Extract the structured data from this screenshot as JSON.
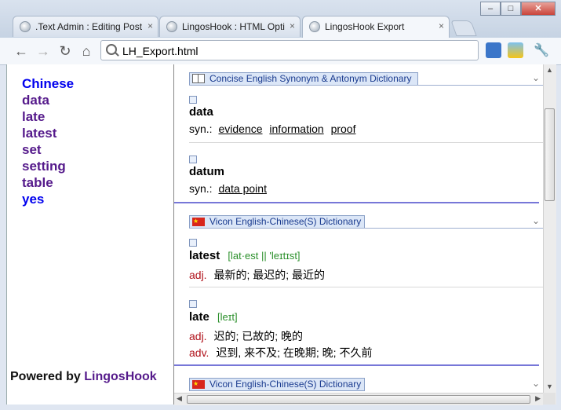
{
  "tabs": [
    {
      "label": ".Text Admin : Editing Post",
      "close": "×"
    },
    {
      "label": "LingosHook : HTML Opti",
      "close": "×"
    },
    {
      "label": "LingosHook Export",
      "close": "×"
    }
  ],
  "window_controls": {
    "minimize": "–",
    "maximize": "□",
    "close": "✕"
  },
  "address": {
    "value": "LH_Export.html"
  },
  "word_list": [
    {
      "word": "Chinese",
      "state": "unvisited"
    },
    {
      "word": "data",
      "state": "visited"
    },
    {
      "word": "late",
      "state": "visited"
    },
    {
      "word": "latest",
      "state": "visited"
    },
    {
      "word": "set",
      "state": "visited"
    },
    {
      "word": "setting",
      "state": "visited"
    },
    {
      "word": "table",
      "state": "visited"
    },
    {
      "word": "yes",
      "state": "unvisited"
    }
  ],
  "powered": {
    "prefix": "Powered by ",
    "brand": "LingosHook"
  },
  "dictionary_sections": [
    {
      "name": "Concise English Synonym & Antonym Dictionary",
      "icon": "book-icon",
      "entries": [
        {
          "headword": "data",
          "syn_label": "syn.:",
          "synonyms": [
            "evidence",
            "information",
            "proof"
          ]
        },
        {
          "headword": "datum",
          "syn_label": "syn.:",
          "synonyms": [
            "data point"
          ]
        }
      ]
    },
    {
      "name": "Vicon English-Chinese(S) Dictionary",
      "icon": "china-flag-icon",
      "entries": [
        {
          "headword": "latest",
          "phonetic": "[lat·est || 'leɪtɪst]",
          "defs": [
            {
              "pos": "adj.",
              "text": "最新的; 最迟的; 最近的"
            }
          ]
        },
        {
          "headword": "late",
          "phonetic": "[leɪt]",
          "defs": [
            {
              "pos": "adj.",
              "text": "迟的; 已故的; 晚的"
            },
            {
              "pos": "adv.",
              "text": "迟到, 来不及; 在晚期; 晚; 不久前"
            }
          ]
        }
      ]
    },
    {
      "name": "Vicon English-Chinese(S) Dictionary",
      "icon": "china-flag-icon",
      "entries": []
    }
  ],
  "colors": {
    "visited_link": "#551a8b",
    "unvisited_link": "#0000ee",
    "pos": "#b0121b",
    "phonetic": "#2a8f2a",
    "divider": "#7777d8"
  }
}
